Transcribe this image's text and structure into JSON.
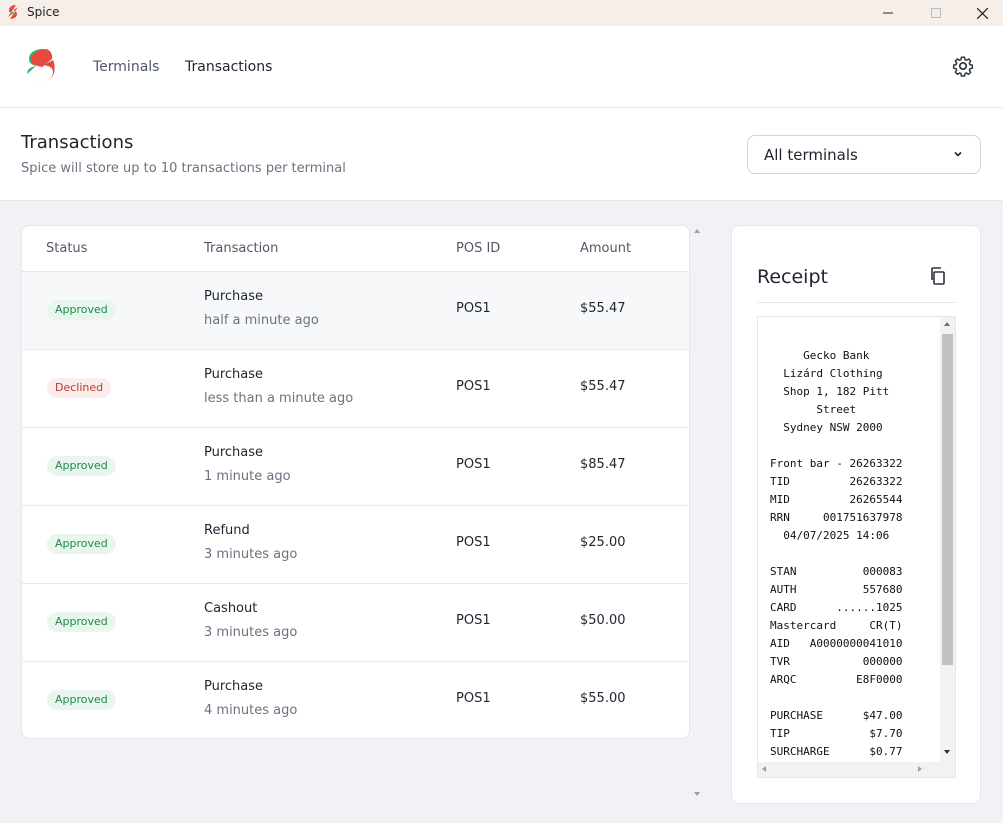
{
  "window": {
    "title": "Spice"
  },
  "nav": {
    "terminals": "Terminals",
    "transactions": "Transactions"
  },
  "page": {
    "title": "Transactions",
    "subtitle": "Spice will store up to 10 transactions per terminal",
    "terminal_filter": "All terminals"
  },
  "table": {
    "headers": {
      "status": "Status",
      "transaction": "Transaction",
      "pos_id": "POS ID",
      "amount": "Amount"
    },
    "rows": [
      {
        "status": "Approved",
        "type": "Purchase",
        "time": "half a minute ago",
        "pos": "POS1",
        "amount": "$55.47"
      },
      {
        "status": "Declined",
        "type": "Purchase",
        "time": "less than a minute ago",
        "pos": "POS1",
        "amount": "$55.47"
      },
      {
        "status": "Approved",
        "type": "Purchase",
        "time": "1 minute ago",
        "pos": "POS1",
        "amount": "$85.47"
      },
      {
        "status": "Approved",
        "type": "Refund",
        "time": "3 minutes ago",
        "pos": "POS1",
        "amount": "$25.00"
      },
      {
        "status": "Approved",
        "type": "Cashout",
        "time": "3 minutes ago",
        "pos": "POS1",
        "amount": "$50.00"
      },
      {
        "status": "Approved",
        "type": "Purchase",
        "time": "4 minutes ago",
        "pos": "POS1",
        "amount": "$55.00"
      }
    ]
  },
  "receipt": {
    "title": "Receipt",
    "text": "     Gecko Bank\n  Lizárd Clothing\n  Shop 1, 182 Pitt\n       Street\n  Sydney NSW 2000\n\nFront bar - 26263322\nTID         26263322\nMID         26265544\nRRN     001751637978\n  04/07/2025 14:06\n\nSTAN          000083\nAUTH          557680\nCARD      ......1025\nMastercard     CR(T)\nAID   A0000000041010\nTVR           000000\nARQC         E8F0000\n\nPURCHASE      $47.00\nTIP            $7.70\nSURCHARGE      $0.77"
  },
  "colors": {
    "approved_bg": "#e9f6ee",
    "approved_text": "#1e8a4c",
    "declined_bg": "#fbecec",
    "declined_text": "#c0392b",
    "logo_red": "#e8493f",
    "logo_green": "#2fb36d"
  }
}
